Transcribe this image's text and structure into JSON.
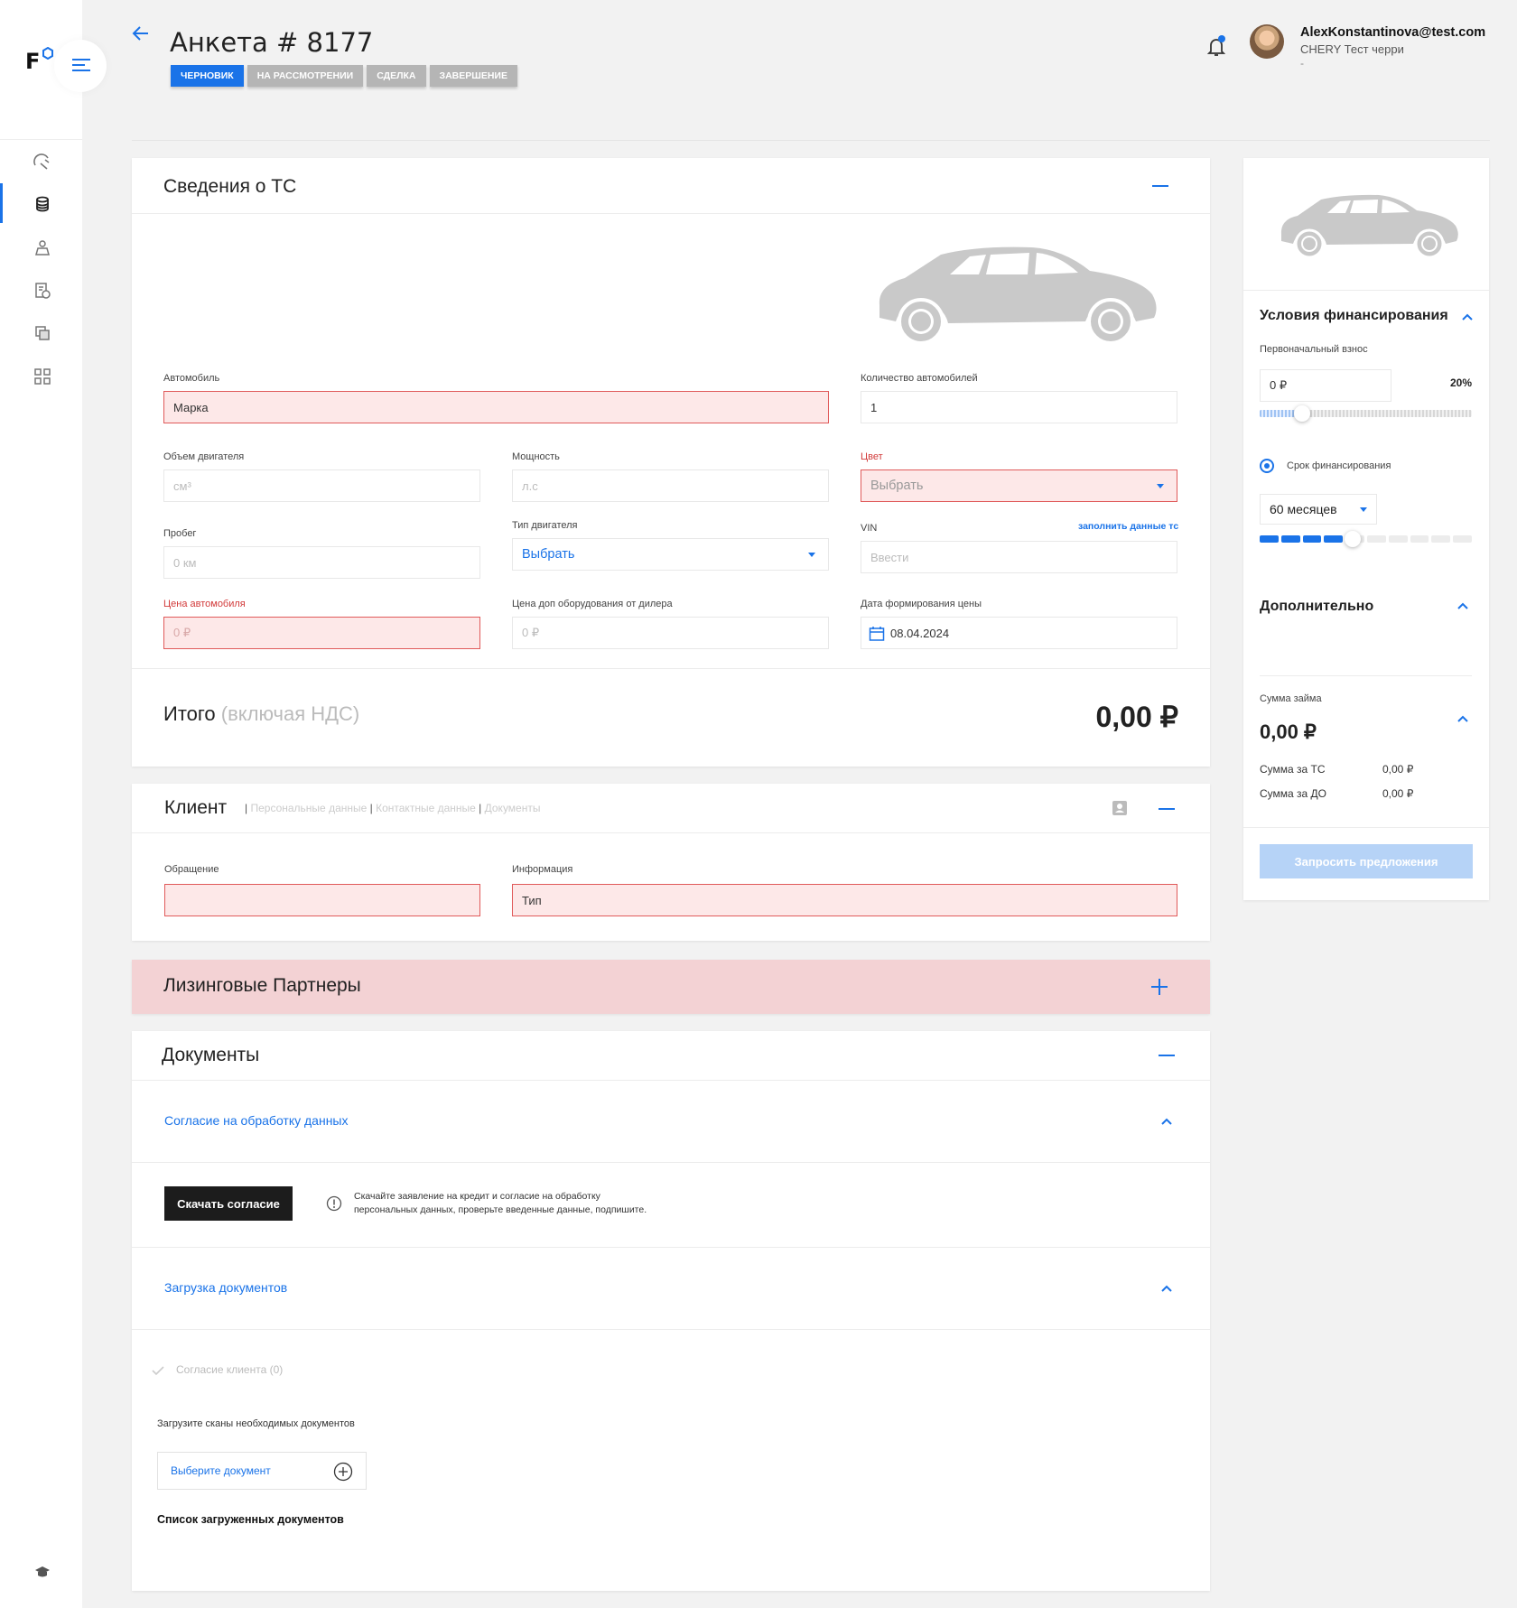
{
  "header": {
    "title": "Анкета # 8177",
    "steps": [
      "ЧЕРНОВИК",
      "НА РАССМОТРЕНИИ",
      "СДЕЛКА",
      "ЗАВЕРШЕНИЕ"
    ],
    "user_email": "AlexKonstantinova@test.com",
    "user_org": "CHERY Тест черри",
    "user_extra": "-"
  },
  "logo": {
    "letter": "F"
  },
  "vehicle": {
    "title": "Сведения о ТС",
    "car_label": "Автомобиль",
    "car_value": "Марка",
    "qty_label": "Количество автомобилей",
    "qty_value": "1",
    "engine_label": "Объем двигателя",
    "engine_placeholder": "см³",
    "power_label": "Мощность",
    "power_placeholder": "л.с",
    "color_label": "Цвет",
    "color_value": "Выбрать",
    "mileage_label": "Пробег",
    "mileage_placeholder": "0 км",
    "engine_type_label": "Тип двигателя",
    "engine_type_value": "Выбрать",
    "vin_label": "VIN",
    "vin_link": "заполнить данные тс",
    "vin_placeholder": "Ввести",
    "price_label": "Цена автомобиля",
    "price_placeholder": "0 ₽",
    "extra_price_label": "Цена доп оборудования от дилера",
    "extra_price_placeholder": "0 ₽",
    "date_label": "Дата формирования цены",
    "date_value": "08.04.2024",
    "total_label": "Итого",
    "total_note": "(включая НДС)",
    "total_value": "0,00 ₽"
  },
  "client": {
    "title": "Клиент",
    "tab_personal": "Персональные данные",
    "tab_contact": "Контактные данные",
    "tab_docs": "Документы",
    "salutation_label": "Обращение",
    "info_label": "Информация",
    "info_value": "Тип"
  },
  "leasing": {
    "title": "Лизинговые Партнеры"
  },
  "documents": {
    "title": "Документы",
    "consent_link": "Согласие на обработку данных",
    "download_button": "Скачать согласие",
    "info_line1": "Скачайте заявление на кредит и согласие на обработку",
    "info_line2": "персональных данных, проверьте введенные данные, подпишите.",
    "upload_link": "Загрузка документов",
    "client_consent": "Согласие клиента (0)",
    "upload_note": "Загрузите сканы необходимых документов",
    "select_doc": "Выберите документ",
    "uploaded_list": "Список загруженных документов"
  },
  "financing": {
    "title": "Условия финансирования",
    "down_payment_label": "Первоначальный взнос",
    "down_payment_value": "0 ₽",
    "down_payment_pct": "20%",
    "down_payment_fraction": 0.2,
    "term_label": "Срок финансирования",
    "term_value": "60 месяцев",
    "term_fraction": 0.44,
    "additional_title": "Дополнительно",
    "loan_label": "Сумма займа",
    "loan_value": "0,00 ₽",
    "vehicle_sum_label": "Сумма за ТС",
    "vehicle_sum_value": "0,00 ₽",
    "extra_sum_label": "Сумма за ДО",
    "extra_sum_value": "0,00 ₽",
    "request_button": "Запросить предложения"
  },
  "colors": {
    "accent": "#1a73e8",
    "error_bg": "#fde8e8",
    "error_border": "#e05a5a",
    "leasing_bg": "#f3d2d4"
  }
}
